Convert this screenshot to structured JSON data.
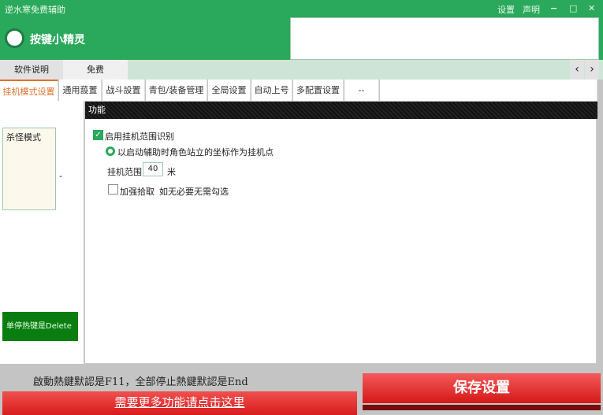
{
  "window": {
    "title": "逆水寒免费辅助",
    "settings": "设置",
    "statement": "声明",
    "minimize": "−",
    "maximize": "□",
    "close": "✕"
  },
  "brand": {
    "name": "按键小精灵"
  },
  "tabs": [
    {
      "label": "软件说明"
    },
    {
      "label": "免费"
    }
  ],
  "nav": {
    "prev": "‹",
    "next": "›"
  },
  "subtabs": [
    {
      "label": "挂机模式设置"
    },
    {
      "label": "通用蔎置"
    },
    {
      "label": "战斗設置"
    },
    {
      "label": "青包/装备管理"
    },
    {
      "label": "全局设置"
    },
    {
      "label": "自动上号"
    },
    {
      "label": "多配置设置"
    },
    {
      "label": "--"
    }
  ],
  "left": {
    "modes": [
      "杀怪模式"
    ],
    "dash": "-",
    "hotkey_button": "单停热键是Delete"
  },
  "panel": {
    "title": "功能",
    "enable_range": "启用挂机范围识别",
    "radio_label": "以启动辅助时角色站立的坐标作为挂机点",
    "range_label": "挂机范围",
    "range_value": "40",
    "range_unit": "米",
    "pickup_label": "加强拾取",
    "pickup_hint": "如无必要无需勾选",
    "enable_checked": true,
    "pickup_checked": false
  },
  "footer": {
    "hotkey_info": "啟動熱鍵默認是F11，全部停止熱鍵默認是End",
    "more_button": "需要更多功能请点击这里",
    "save_button": "保存设置"
  },
  "colors": {
    "green": "#2aa85c",
    "red": "#d81c1c",
    "active_tab": "#e0702a"
  }
}
